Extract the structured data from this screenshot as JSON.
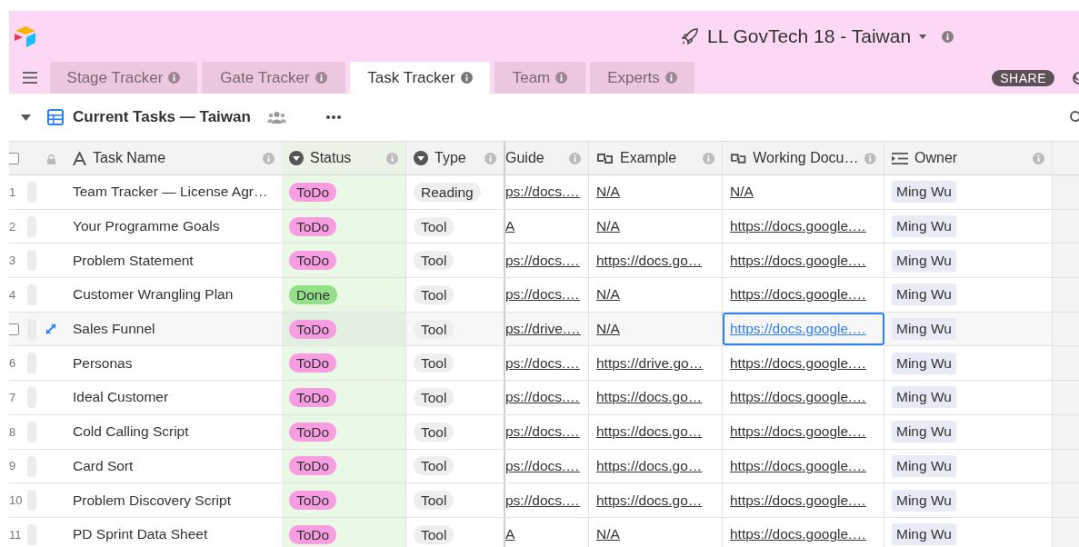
{
  "app": {
    "title": "LL GovTech 18 - Taiwan",
    "share_button": "SHARE"
  },
  "tabs": [
    {
      "label": "Stage Tracker",
      "selected": false
    },
    {
      "label": "Gate Tracker",
      "selected": false
    },
    {
      "label": "Task Tracker",
      "selected": true
    },
    {
      "label": "Team",
      "selected": false
    },
    {
      "label": "Experts",
      "selected": false
    }
  ],
  "view": {
    "name": "Current Tasks — Taiwan"
  },
  "table": {
    "all_checked": false,
    "columns": [
      {
        "label": "Task Name",
        "kind": "text"
      },
      {
        "label": "Status",
        "kind": "select"
      },
      {
        "label": "Type",
        "kind": "select"
      },
      {
        "label": "Guide",
        "kind": "link"
      },
      {
        "label": "Example",
        "kind": "link"
      },
      {
        "label": "Working Docu…",
        "kind": "link"
      },
      {
        "label": "Owner",
        "kind": "user"
      }
    ],
    "rows": [
      {
        "number": "1",
        "hovered": false,
        "name": "Team Tracker — License Agr…",
        "status": {
          "label": "ToDo",
          "color": "#f99de2"
        },
        "type": "Reading",
        "guide": "ps://docs.…",
        "example": "N/A",
        "working_doc": "N/A",
        "working_doc_selected": false,
        "owner": "Ming Wu"
      },
      {
        "number": "2",
        "hovered": false,
        "name": "Your Programme Goals",
        "status": {
          "label": "ToDo",
          "color": "#f99de2"
        },
        "type": "Tool",
        "guide": "A",
        "example": "N/A",
        "working_doc": "https://docs.google.…",
        "working_doc_selected": false,
        "owner": "Ming Wu"
      },
      {
        "number": "3",
        "hovered": false,
        "name": "Problem Statement",
        "status": {
          "label": "ToDo",
          "color": "#f99de2"
        },
        "type": "Tool",
        "guide": "ps://docs.…",
        "example": "https://docs.go…",
        "working_doc": "https://docs.google.…",
        "working_doc_selected": false,
        "owner": "Ming Wu"
      },
      {
        "number": "4",
        "hovered": false,
        "name": "Customer Wrangling Plan",
        "status": {
          "label": "Done",
          "color": "#93e088"
        },
        "type": "Tool",
        "guide": "ps://docs.…",
        "example": "N/A",
        "working_doc": "https://docs.google.…",
        "working_doc_selected": false,
        "owner": "Ming Wu"
      },
      {
        "hovered": true,
        "checked": false,
        "name": "Sales Funnel",
        "status": {
          "label": "ToDo",
          "color": "#f99de2"
        },
        "type": "Tool",
        "guide": "ps://drive.…",
        "example": "N/A",
        "working_doc": "https://docs.google.…",
        "working_doc_selected": true,
        "owner": "Ming Wu"
      },
      {
        "number": "6",
        "hovered": false,
        "name": "Personas",
        "status": {
          "label": "ToDo",
          "color": "#f99de2"
        },
        "type": "Tool",
        "guide": "ps://docs.…",
        "example": "https://drive.go…",
        "working_doc": "https://docs.google.…",
        "working_doc_selected": false,
        "owner": "Ming Wu"
      },
      {
        "number": "7",
        "hovered": false,
        "name": "Ideal Customer",
        "status": {
          "label": "ToDo",
          "color": "#f99de2"
        },
        "type": "Tool",
        "guide": "ps://docs.…",
        "example": "https://docs.go…",
        "working_doc": "https://docs.google.…",
        "working_doc_selected": false,
        "owner": "Ming Wu"
      },
      {
        "number": "8",
        "hovered": false,
        "name": "Cold Calling Script",
        "status": {
          "label": "ToDo",
          "color": "#f99de2"
        },
        "type": "Tool",
        "guide": "ps://docs.…",
        "example": "https://docs.go…",
        "working_doc": "https://docs.google.…",
        "working_doc_selected": false,
        "owner": "Ming Wu"
      },
      {
        "number": "9",
        "hovered": false,
        "name": "Card Sort",
        "status": {
          "label": "ToDo",
          "color": "#f99de2"
        },
        "type": "Tool",
        "guide": "ps://docs.…",
        "example": "https://docs.go…",
        "working_doc": "https://docs.google.…",
        "working_doc_selected": false,
        "owner": "Ming Wu"
      },
      {
        "number": "10",
        "hovered": false,
        "name": "Problem Discovery Script",
        "status": {
          "label": "ToDo",
          "color": "#f99de2"
        },
        "type": "Tool",
        "guide": "ps://docs.…",
        "example": "https://docs.go…",
        "working_doc": "https://docs.google.…",
        "working_doc_selected": false,
        "owner": "Ming Wu"
      },
      {
        "number": "11",
        "hovered": false,
        "name": "PD Sprint Data Sheet",
        "status": {
          "label": "ToDo",
          "color": "#f99de2"
        },
        "type": "Tool",
        "guide": "A",
        "example": "N/A",
        "working_doc": "https://docs.google.…",
        "working_doc_selected": false,
        "owner": "Ming Wu"
      }
    ]
  }
}
